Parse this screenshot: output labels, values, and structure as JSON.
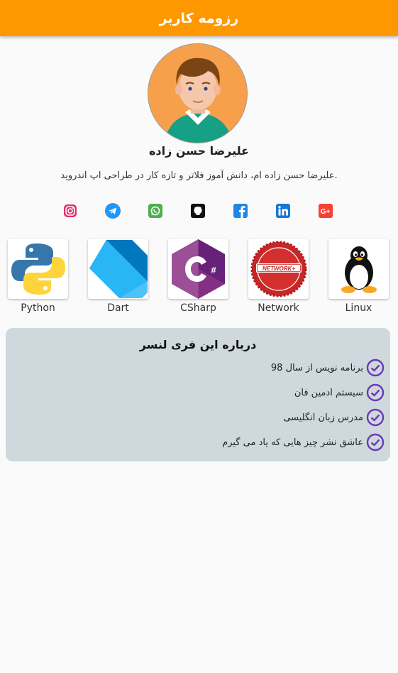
{
  "appbar": {
    "title": "رزومه کاربر",
    "color": "#ff9800"
  },
  "profile": {
    "name": "علیرضا حسن زاده",
    "bio": ".علیرضا حسن زاده ام، دانش آموز فلاتر و تازه کار در طراحی اپ اندروید"
  },
  "social": [
    {
      "icon": "instagram-icon",
      "color": "#e1306c"
    },
    {
      "icon": "telegram-icon",
      "color": "#2196f3"
    },
    {
      "icon": "whatsapp-icon",
      "color": "#4caf50"
    },
    {
      "icon": "github-icon",
      "color": "#111111"
    },
    {
      "icon": "facebook-icon",
      "color": "#1e88e5"
    },
    {
      "icon": "linkedin-icon",
      "color": "#1976d2"
    },
    {
      "icon": "google-plus-icon",
      "color": "#f44336"
    }
  ],
  "skills": [
    {
      "label": "Python",
      "icon": "python-logo"
    },
    {
      "label": "Dart",
      "icon": "dart-logo"
    },
    {
      "label": "CSharp",
      "icon": "csharp-logo"
    },
    {
      "label": "Network",
      "icon": "comptia-network-logo"
    },
    {
      "label": "Linux",
      "icon": "linux-tux-logo"
    }
  ],
  "about": {
    "title": "درباره این فری لنسر",
    "items": [
      "برنامه نویس از سال 98",
      "سیستم ادمین فان",
      "مدرس زبان انگلیسی",
      "عاشق نشر چیز هایی که یاد می گیرم"
    ],
    "check_color": "#673ab7",
    "panel_color": "#cfd8dc"
  }
}
